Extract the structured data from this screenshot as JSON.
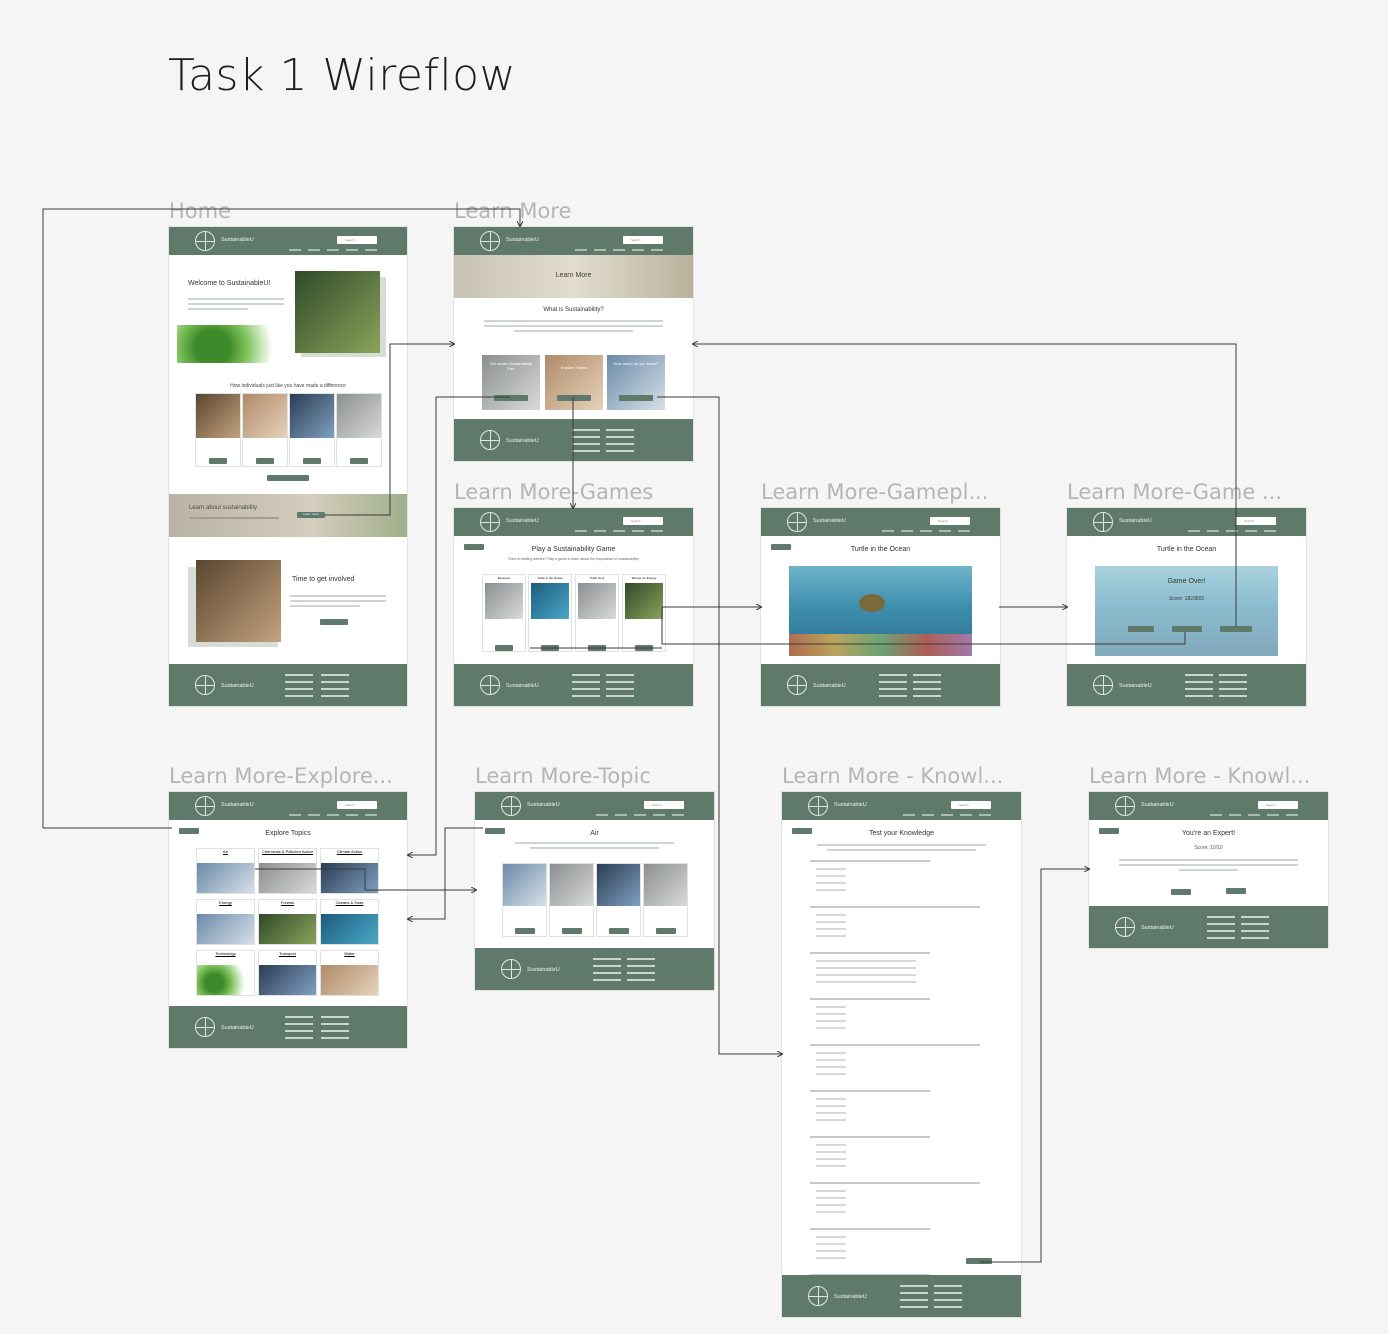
{
  "title": "Task 1 Wireflow",
  "brand": "SustainableU",
  "search_placeholder": "Search",
  "frames": {
    "home": {
      "label": "Home",
      "welcome": "Welcome to SustainableU!",
      "individuals_heading": "How individuals just like you have made a difference",
      "learn_banner": "Learn about sustainability",
      "banner_button": "Learn more",
      "involved": "Time to get involved",
      "involved_button": "Let's Go!"
    },
    "learn_more": {
      "label": "Learn More",
      "hero": "Learn More",
      "question": "What is Sustainability?",
      "tiles": [
        "We mean Sustainability Part",
        "Explore Topics",
        "How much do you know?"
      ]
    },
    "games": {
      "label": "Learn More-Games",
      "heading": "Play a Sustainability Game",
      "sub": "Tired of reading articles? Play a game to learn about the importance of sustainability!",
      "games": [
        "Ecoscore",
        "Turtle in the Ocean",
        "Trash Hunt",
        "Renew my Energy"
      ]
    },
    "gameplay": {
      "label": "Learn More-Gamepl...",
      "heading": "Turtle in the Ocean"
    },
    "gameover": {
      "label": "Learn More-Game ...",
      "heading": "Turtle in the Ocean",
      "over": "Game Over!",
      "score": "Score: 1823802"
    },
    "explore": {
      "label": "Learn More-Explore...",
      "heading": "Explore Topics",
      "topics": [
        "Air",
        "Chemicals & Pollution Action",
        "Climate Action",
        "Energy",
        "Forests",
        "Oceans & Seas",
        "Technology",
        "Transport",
        "Water"
      ]
    },
    "topic": {
      "label": "Learn More-Topic",
      "heading": "Air"
    },
    "knowledge": {
      "label": "Learn More - Knowl...",
      "heading": "Test your Knowledge"
    },
    "expert": {
      "label": "Learn More - Knowl...",
      "heading": "You're an Expert!",
      "score": "Score: 10/10"
    }
  },
  "colors": {
    "brand_green": "#5f7a6b",
    "flow_line": "#3a3a3a",
    "label_gray": "#b5b5b5"
  }
}
